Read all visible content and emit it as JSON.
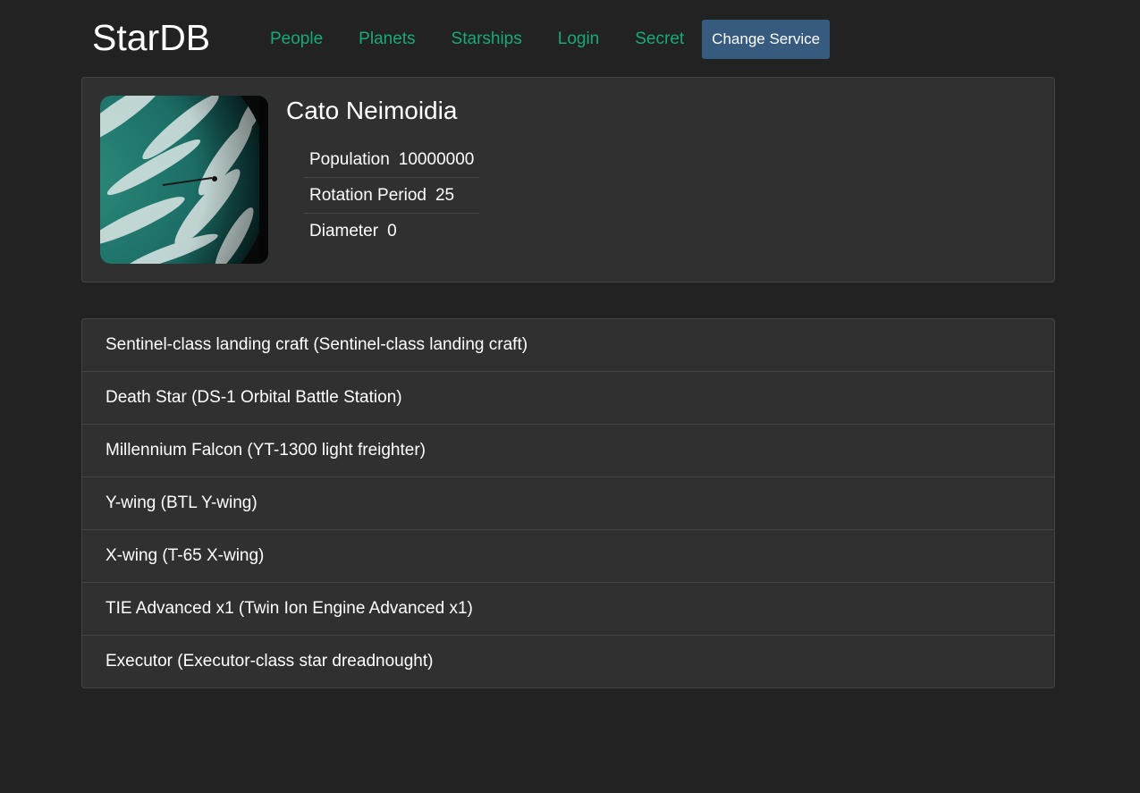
{
  "header": {
    "brand": "StarDB",
    "nav": [
      "People",
      "Planets",
      "Starships",
      "Login",
      "Secret"
    ],
    "change_service_label": "Change Service"
  },
  "planet": {
    "name": "Cato Neimoidia",
    "stats": [
      {
        "label": "Population",
        "value": "10000000"
      },
      {
        "label": "Rotation Period",
        "value": "25"
      },
      {
        "label": "Diameter",
        "value": "0"
      }
    ]
  },
  "items": [
    "Sentinel-class landing craft (Sentinel-class landing craft)",
    "Death Star (DS-1 Orbital Battle Station)",
    "Millennium Falcon (YT-1300 light freighter)",
    "Y-wing (BTL Y-wing)",
    "X-wing (T-65 X-wing)",
    "TIE Advanced x1 (Twin Ion Engine Advanced x1)",
    "Executor (Executor-class star dreadnought)"
  ],
  "colors": {
    "background": "#222222",
    "card": "#303030",
    "link": "#18a97a",
    "button": "#375a7f"
  }
}
